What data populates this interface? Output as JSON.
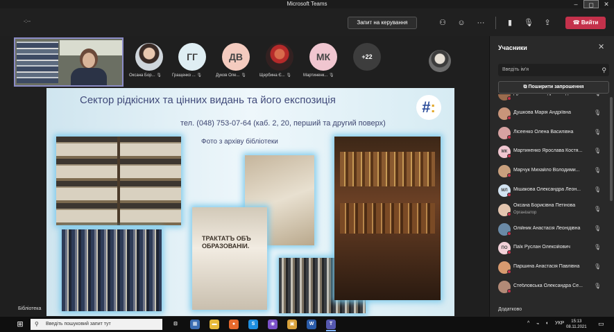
{
  "window": {
    "title": "Microsoft Teams",
    "min_icon": "–",
    "max_icon": "◻",
    "close_icon": "✕"
  },
  "meeting_bar": {
    "timer": "-:--",
    "request_control": "Запит на керування",
    "people_icon": "⚇",
    "reactions_icon": "☺",
    "more_icon": "···",
    "camera_icon": "▮",
    "mic_icon": "🎙",
    "share_icon": "⇪",
    "leave_icon": "☎",
    "leave_label": "Вийти"
  },
  "strip": {
    "tiles": [
      {
        "initials": "",
        "name": "Оксана Бор...",
        "style": "photo1",
        "color": ""
      },
      {
        "initials": "ГГ",
        "name": "Гращенко ...",
        "style": "initials",
        "color": "#dfeef3"
      },
      {
        "initials": "ДВ",
        "name": "Дуков Оле...",
        "style": "initials",
        "color": "#f4cbbf"
      },
      {
        "initials": "",
        "name": "Щербина Є...",
        "style": "photo2",
        "color": ""
      },
      {
        "initials": "МК",
        "name": "Мартиненк...",
        "style": "initials",
        "color": "#f0c6d0"
      },
      {
        "initials": "+22",
        "name": "",
        "style": "more",
        "color": ""
      }
    ],
    "mic_icon": "🎙"
  },
  "slide": {
    "title": "Сектор рідкісних та цінних видань  та його експозиція",
    "phone": "тел. (048) 753-07-64  (каб. 2, 20, перший та другий поверх)",
    "archive": "Фото з архіву бібліотеки",
    "book_title": "ТРАКТАТЪ ОБЪ ОБРАЗОВАНІИ."
  },
  "sharer_name": "Бібліотека",
  "panel": {
    "title": "Учасники",
    "close_icon": "✕",
    "search_placeholder": "Введіть ім'я",
    "search_icon": "⚲",
    "invite_label": "Поширити запрошення",
    "invite_icon": "⧉",
    "mic_off_icon": "🎙",
    "participants": [
      {
        "name": "Дуков Олександр Володими...",
        "initials": "",
        "color": "#9a6b4d",
        "role": ""
      },
      {
        "name": "Душкова Марія Андріївна",
        "initials": "",
        "color": "#c8957a",
        "role": ""
      },
      {
        "name": "Лісеенко Олена Василівна",
        "initials": "",
        "color": "#d6a2a2",
        "role": ""
      },
      {
        "name": "Мартиненко Ярослава Костя...",
        "initials": "МК",
        "color": "#f0c6d0",
        "role": ""
      },
      {
        "name": "Марчук Михайло Володими...",
        "initials": "",
        "color": "#c9a07d",
        "role": ""
      },
      {
        "name": "Мішакова Олександра Леон...",
        "initials": "МЛ",
        "color": "#d2e3f2",
        "role": ""
      },
      {
        "name": "Оксана Борисівна Петінова",
        "initials": "",
        "color": "#e3c5ae",
        "role": "Організатор"
      },
      {
        "name": "Олійник Анастасія Леонідівна",
        "initials": "",
        "color": "#6a8aa6",
        "role": ""
      },
      {
        "name": "Паїк Руслан Олексійович",
        "initials": "ПО",
        "color": "#f2d1d8",
        "role": ""
      },
      {
        "name": "Паршина Анастасія Павлівна",
        "initials": "",
        "color": "#d79a6f",
        "role": ""
      },
      {
        "name": "Стебловська Олександра Се...",
        "initials": "",
        "color": "#b28a77",
        "role": ""
      }
    ],
    "add_label": "Додатково"
  },
  "taskbar": {
    "start_icon": "⊞",
    "search_text": "Введіть пошуковий запит тут",
    "search_icon": "⚲",
    "apps": [
      {
        "name": "task-view",
        "glyph": "⊟",
        "color": "#0f0f0f"
      },
      {
        "name": "calculator",
        "glyph": "▦",
        "color": "#3b6db3"
      },
      {
        "name": "file-explorer",
        "glyph": "▬",
        "color": "#e7b93a"
      },
      {
        "name": "firefox",
        "glyph": "●",
        "color": "#e7692c"
      },
      {
        "name": "skype",
        "glyph": "S",
        "color": "#1e8fe0"
      },
      {
        "name": "viber",
        "glyph": "◉",
        "color": "#7b51c9"
      },
      {
        "name": "photos",
        "glyph": "▣",
        "color": "#d9a23b"
      },
      {
        "name": "word",
        "glyph": "W",
        "color": "#2a5ba8"
      },
      {
        "name": "teams",
        "glyph": "T",
        "color": "#5558af"
      }
    ],
    "tray_chevron": "^",
    "tray_network": "⌁",
    "tray_volume": "◖",
    "language": "УКР",
    "time": "15:13",
    "date": "08.11.2021",
    "notif_icon": "▭"
  }
}
